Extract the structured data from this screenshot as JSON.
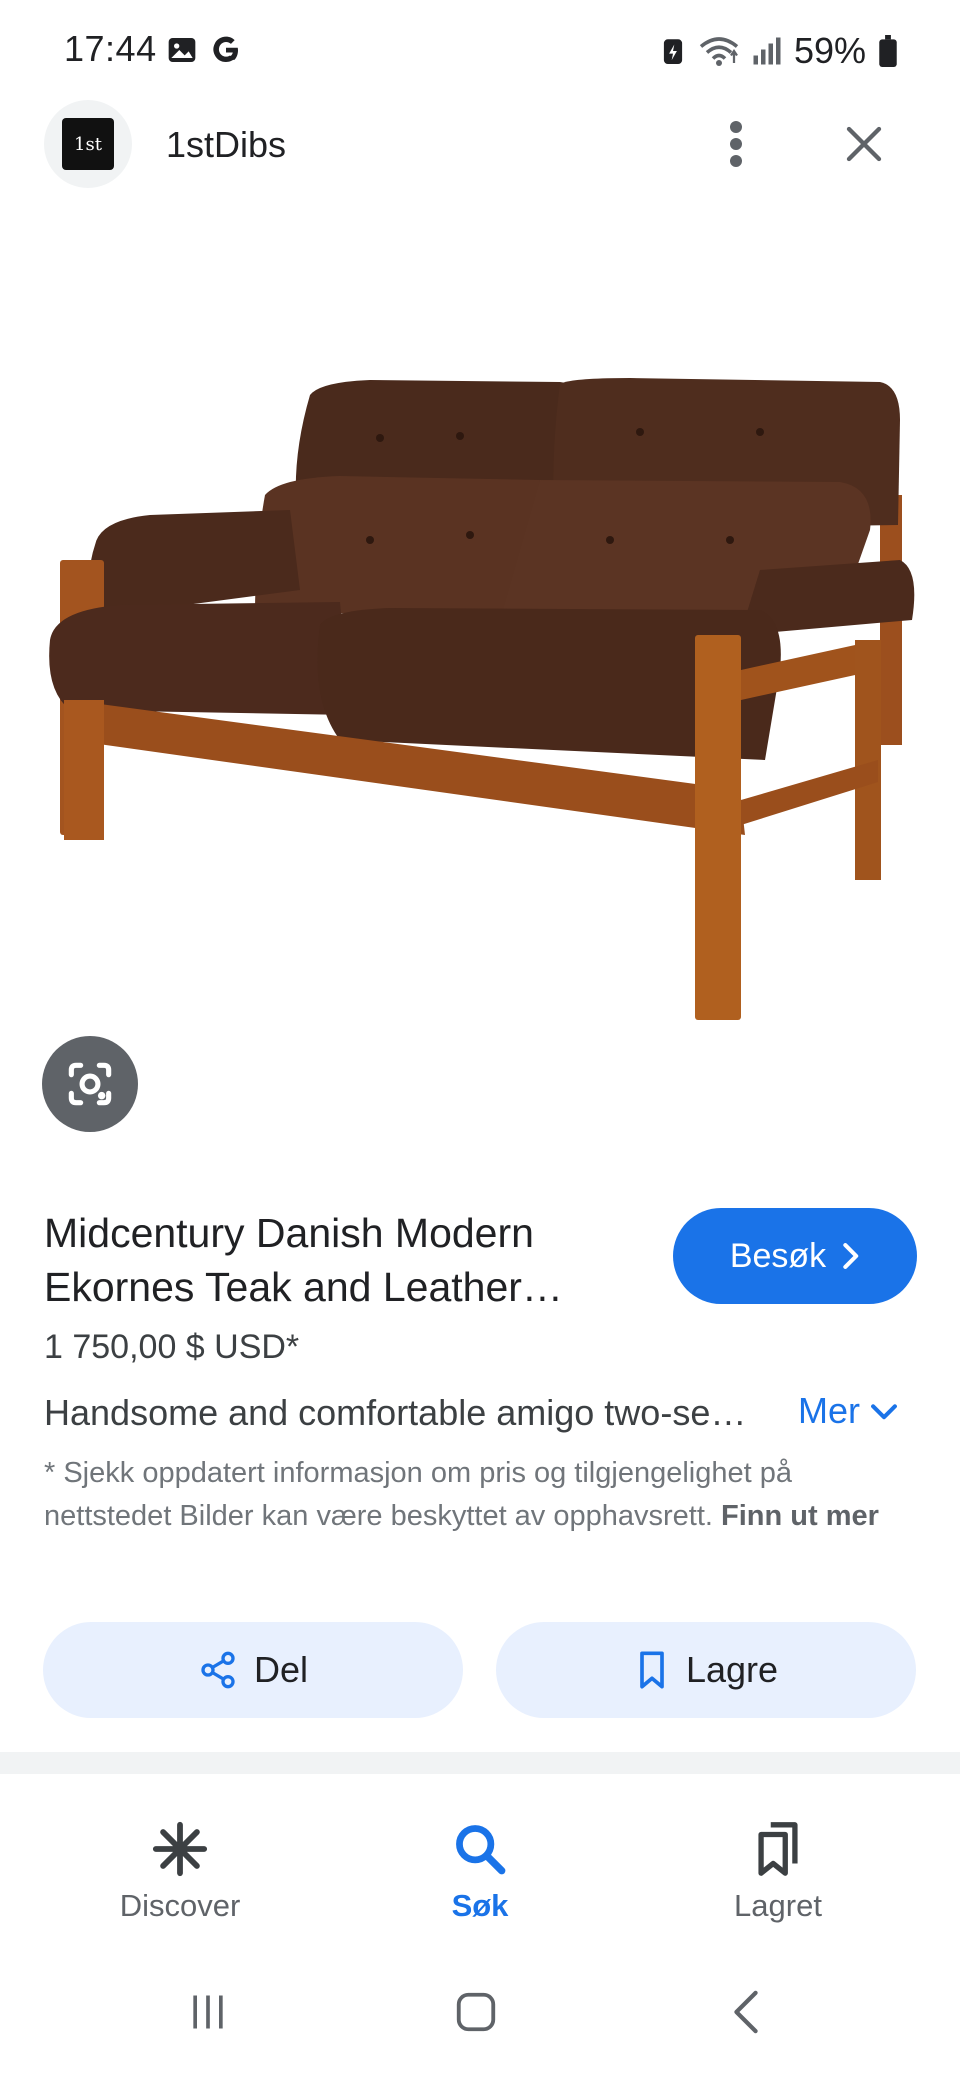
{
  "status_bar": {
    "time": "17:44",
    "battery": "59%",
    "icons": [
      "image-icon",
      "google-icon",
      "battery-saver-icon",
      "wifi-icon",
      "signal-icon",
      "battery-icon"
    ]
  },
  "header": {
    "site_name": "1stDibs",
    "logo_text": "1st",
    "more_icon": "more-vert-icon",
    "close_icon": "close-icon"
  },
  "product": {
    "image_alt": "Brown leather two-seater sofa with teak frame",
    "title_line1": "Midcentury Danish Modern",
    "title_line2": "Ekornes Teak and Leather…",
    "visit_label": "Besøk",
    "price": "1 750,00 $ USD*",
    "description": "Handsome and comfortable amigo two-se…",
    "more_label": "Mer",
    "disclaimer_text": "* Sjekk oppdatert informasjon om pris og tilgjengelighet på nettstedet Bilder kan være beskyttet av opphavsrett. ",
    "disclaimer_link": "Finn ut mer"
  },
  "actions": {
    "share_label": "Del",
    "save_label": "Lagre"
  },
  "bottom_nav": {
    "items": [
      {
        "label": "Discover",
        "icon": "asterisk-icon",
        "active": false
      },
      {
        "label": "Søk",
        "icon": "search-icon",
        "active": true
      },
      {
        "label": "Lagret",
        "icon": "saved-icon",
        "active": false
      }
    ]
  },
  "colors": {
    "accent": "#1a73e8",
    "action_bg": "#e8f0fe",
    "lens_bg": "#5f6368"
  }
}
